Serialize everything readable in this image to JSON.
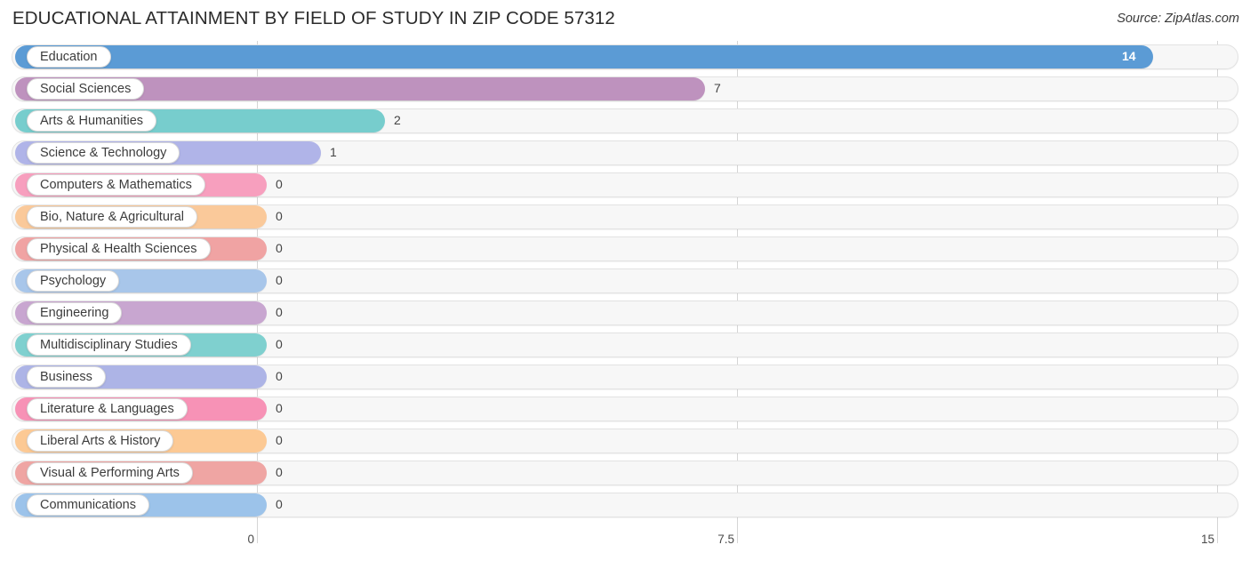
{
  "header": {
    "title": "EDUCATIONAL ATTAINMENT BY FIELD OF STUDY IN ZIP CODE 57312",
    "source": "Source: ZipAtlas.com"
  },
  "chart_data": {
    "type": "bar",
    "orientation": "horizontal",
    "title": "EDUCATIONAL ATTAINMENT BY FIELD OF STUDY IN ZIP CODE 57312",
    "subtitle": "",
    "xlabel": "",
    "ylabel": "",
    "xlim": [
      0,
      15
    ],
    "grid": true,
    "legend": "none",
    "tick_labels": [
      "0",
      "7.5",
      "15"
    ],
    "tick_values": [
      0,
      7.5,
      15
    ],
    "categories": [
      "Education",
      "Social Sciences",
      "Arts & Humanities",
      "Science & Technology",
      "Computers & Mathematics",
      "Bio, Nature & Agricultural",
      "Physical & Health Sciences",
      "Psychology",
      "Engineering",
      "Multidisciplinary Studies",
      "Business",
      "Literature & Languages",
      "Liberal Arts & History",
      "Visual & Performing Arts",
      "Communications"
    ],
    "values": [
      14,
      7,
      2,
      1,
      0,
      0,
      0,
      0,
      0,
      0,
      0,
      0,
      0,
      0,
      0
    ],
    "value_labels": [
      "14",
      "7",
      "2",
      "1",
      "0",
      "0",
      "0",
      "0",
      "0",
      "0",
      "0",
      "0",
      "0",
      "0",
      "0"
    ],
    "colors": [
      "#5b9bd5",
      "#be92be",
      "#77cdcd",
      "#b0b4e8",
      "#f79fbe",
      "#fac99a",
      "#f0a3a3",
      "#a8c6ea",
      "#c8a6d0",
      "#7fd0cf",
      "#adb4e6",
      "#f792b6",
      "#fcc994",
      "#efa5a3",
      "#9cc3ea"
    ]
  }
}
